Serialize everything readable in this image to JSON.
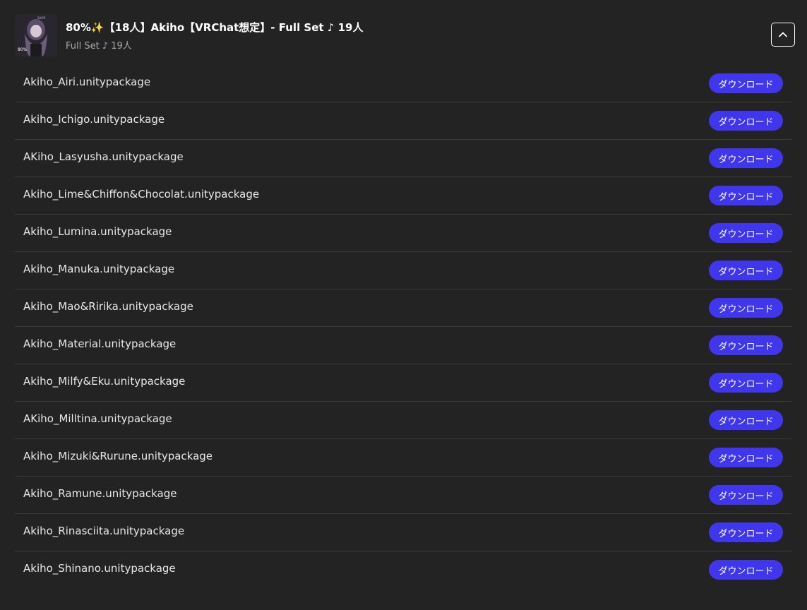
{
  "header": {
    "title": "80%✨【18人】Akiho【VRChat想定】- Full Set ♪ 19人",
    "subtitle": "Full Set ♪ 19人",
    "thumbnail_icon": "product-thumbnail",
    "collapse_icon": "chevron-up-icon"
  },
  "download_label": "ダウンロード",
  "files": [
    {
      "name": "Akiho_Airi.unitypackage",
      "action": "ダウンロード"
    },
    {
      "name": "Akiho_Ichigo.unitypackage",
      "action": "ダウンロード"
    },
    {
      "name": "AKiho_Lasyusha.unitypackage",
      "action": "ダウンロード"
    },
    {
      "name": "Akiho_Lime&Chiffon&Chocolat.unitypackage",
      "action": "ダウンロード"
    },
    {
      "name": "Akiho_Lumina.unitypackage",
      "action": "ダウンロード"
    },
    {
      "name": "Akiho_Manuka.unitypackage",
      "action": "ダウンロード"
    },
    {
      "name": "Akiho_Mao&Ririka.unitypackage",
      "action": "ダウンロード"
    },
    {
      "name": "Akiho_Material.unitypackage",
      "action": "ダウンロード"
    },
    {
      "name": "Akiho_Milfy&Eku.unitypackage",
      "action": "ダウンロード"
    },
    {
      "name": "AKiho_Milltina.unitypackage",
      "action": "ダウンロード"
    },
    {
      "name": "Akiho_Mizuki&Rurune.unitypackage",
      "action": "ダウンロード"
    },
    {
      "name": "Akiho_Ramune.unitypackage",
      "action": "ダウンロード"
    },
    {
      "name": "Akiho_Rinasciita.unitypackage",
      "action": "ダウンロード"
    },
    {
      "name": "Akiho_Shinano.unitypackage",
      "action": "ダウンロード"
    }
  ],
  "colors": {
    "background": "#232323",
    "button": "#3f36ee",
    "divider": "#3a3a3a"
  }
}
